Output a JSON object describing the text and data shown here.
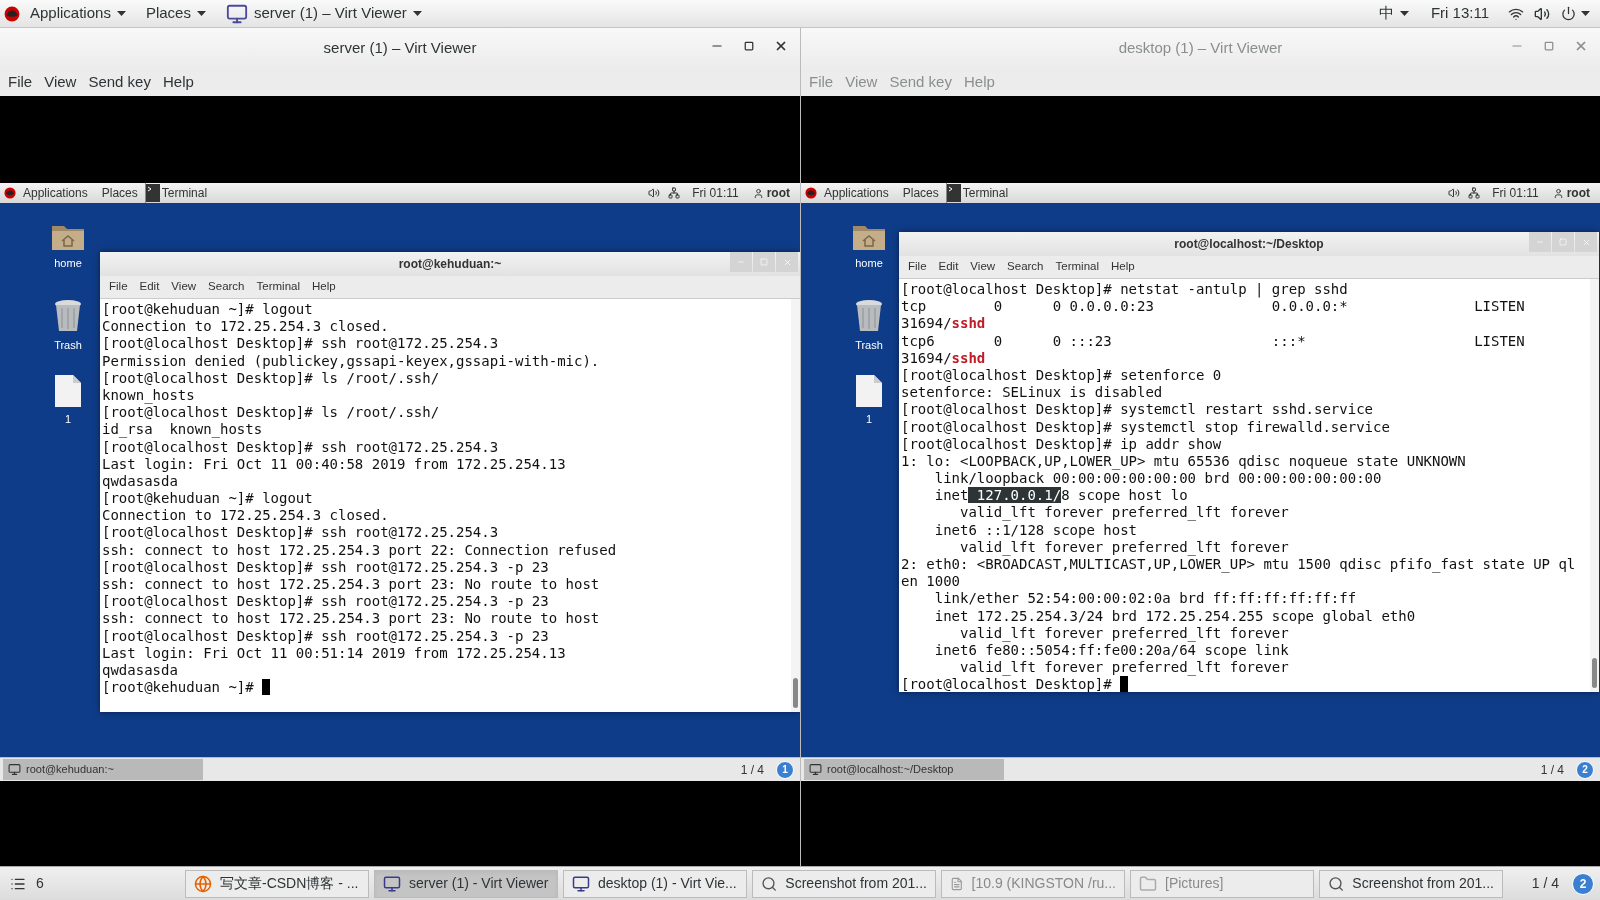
{
  "top_bar": {
    "menus": [
      "Applications",
      "Places"
    ],
    "app_menu": "server (1) – Virt Viewer",
    "input_method": "中",
    "clock": "Fri 13:11"
  },
  "viewers": [
    {
      "title": "server (1) – Virt Viewer",
      "active": true,
      "menu": [
        "File",
        "View",
        "Send key",
        "Help"
      ],
      "guest": {
        "panel": {
          "menus": [
            "Applications",
            "Places"
          ],
          "task": "Terminal",
          "clock": "Fri 01:11",
          "user": "root"
        },
        "desktop_icons": [
          {
            "label": "home",
            "kind": "folder"
          },
          {
            "label": "Trash",
            "kind": "trash"
          },
          {
            "label": "1",
            "kind": "file"
          }
        ],
        "terminal": {
          "title": "root@kehuduan:~",
          "menu": [
            "File",
            "Edit",
            "View",
            "Search",
            "Terminal",
            "Help"
          ],
          "lines": [
            "[root@kehuduan ~]# logout",
            "Connection to 172.25.254.3 closed.",
            "[root@localhost Desktop]# ssh root@172.25.254.3",
            "Permission denied (publickey,gssapi-keyex,gssapi-with-mic).",
            "[root@localhost Desktop]# ls /root/.ssh/",
            "known_hosts",
            "[root@localhost Desktop]# ls /root/.ssh/",
            "id_rsa  known_hosts",
            "[root@localhost Desktop]# ssh root@172.25.254.3",
            "Last login: Fri Oct 11 00:40:58 2019 from 172.25.254.13",
            "qwdasasda",
            "[root@kehuduan ~]# logout",
            "Connection to 172.25.254.3 closed.",
            "[root@localhost Desktop]# ssh root@172.25.254.3",
            "ssh: connect to host 172.25.254.3 port 22: Connection refused",
            "[root@localhost Desktop]# ssh root@172.25.254.3 -p 23",
            "ssh: connect to host 172.25.254.3 port 23: No route to host",
            "[root@localhost Desktop]# ssh root@172.25.254.3 -p 23",
            "ssh: connect to host 172.25.254.3 port 23: No route to host",
            "[root@localhost Desktop]# ssh root@172.25.254.3 -p 23",
            "Last login: Fri Oct 11 00:51:14 2019 from 172.25.254.13",
            "qwdasasda",
            "[root@kehuduan ~]# "
          ]
        },
        "bottom_bar": {
          "task": "root@kehuduan:~",
          "pager": "1 / 4",
          "workspace": "1"
        }
      }
    },
    {
      "title": "desktop (1) – Virt Viewer",
      "active": false,
      "menu": [
        "File",
        "View",
        "Send key",
        "Help"
      ],
      "guest": {
        "panel": {
          "menus": [
            "Applications",
            "Places"
          ],
          "task": "Terminal",
          "clock": "Fri 01:11",
          "user": "root"
        },
        "desktop_icons": [
          {
            "label": "home",
            "kind": "folder"
          },
          {
            "label": "Trash",
            "kind": "trash"
          },
          {
            "label": "1",
            "kind": "file"
          }
        ],
        "terminal": {
          "title": "root@localhost:~/Desktop",
          "menu": [
            "File",
            "Edit",
            "View",
            "Search",
            "Terminal",
            "Help"
          ],
          "lines": [
            "[root@localhost Desktop]# netstat -antulp | grep sshd",
            "tcp        0      0 0.0.0.0:23              0.0.0.0:*               LISTEN",
            {
              "parts": [
                {
                  "text": "31694/",
                  "kind": "plain"
                },
                {
                  "text": "sshd",
                  "kind": "match"
                }
              ]
            },
            "tcp6       0      0 :::23                   :::*                    LISTEN",
            {
              "parts": [
                {
                  "text": "31694/",
                  "kind": "plain"
                },
                {
                  "text": "sshd",
                  "kind": "match"
                }
              ]
            },
            "[root@localhost Desktop]# setenforce 0",
            "setenforce: SELinux is disabled",
            "[root@localhost Desktop]# systemctl restart sshd.service",
            "[root@localhost Desktop]# systemctl stop firewalld.service",
            "[root@localhost Desktop]# ip addr show",
            "1: lo: <LOOPBACK,UP,LOWER_UP> mtu 65536 qdisc noqueue state UNKNOWN",
            "    link/loopback 00:00:00:00:00:00 brd 00:00:00:00:00:00",
            {
              "parts": [
                {
                  "text": "    inet",
                  "kind": "plain"
                },
                {
                  "text": " 127.0.0.1/",
                  "kind": "selection"
                },
                {
                  "text": "8 scope host lo",
                  "kind": "plain"
                }
              ]
            },
            "       valid_lft forever preferred_lft forever",
            "    inet6 ::1/128 scope host",
            "       valid_lft forever preferred_lft forever",
            "2: eth0: <BROADCAST,MULTICAST,UP,LOWER_UP> mtu 1500 qdisc pfifo_fast state UP ql",
            "en 1000",
            "    link/ether 52:54:00:00:02:0a brd ff:ff:ff:ff:ff:ff",
            "    inet 172.25.254.3/24 brd 172.25.254.255 scope global eth0",
            "       valid_lft forever preferred_lft forever",
            "    inet6 fe80::5054:ff:fe00:20a/64 scope link",
            "       valid_lft forever preferred_lft forever",
            "[root@localhost Desktop]# "
          ]
        },
        "bottom_bar": {
          "task": "root@localhost:~/Desktop",
          "pager": "1 / 4",
          "workspace": "2"
        }
      }
    }
  ],
  "taskbar": {
    "count": "6",
    "items": [
      {
        "label": "写文章-CSDN博客 - ...",
        "kind": "browser",
        "selected": false,
        "minimized": false
      },
      {
        "label": "server (1) - Virt Viewer",
        "kind": "viewer",
        "selected": true,
        "minimized": false
      },
      {
        "label": "desktop (1) - Virt Vie...",
        "kind": "viewer",
        "selected": false,
        "minimized": false
      },
      {
        "label": "Screenshot from 201...",
        "kind": "screenshot",
        "selected": false,
        "minimized": false
      },
      {
        "label": "[10.9 (KINGSTON /ru...",
        "kind": "editor",
        "selected": false,
        "minimized": true
      },
      {
        "label": "[Pictures]",
        "kind": "folder",
        "selected": false,
        "minimized": true
      },
      {
        "label": "Screenshot from 201...",
        "kind": "screenshot",
        "selected": false,
        "minimized": false
      }
    ],
    "pager": "1 / 4",
    "workspace": "2"
  }
}
